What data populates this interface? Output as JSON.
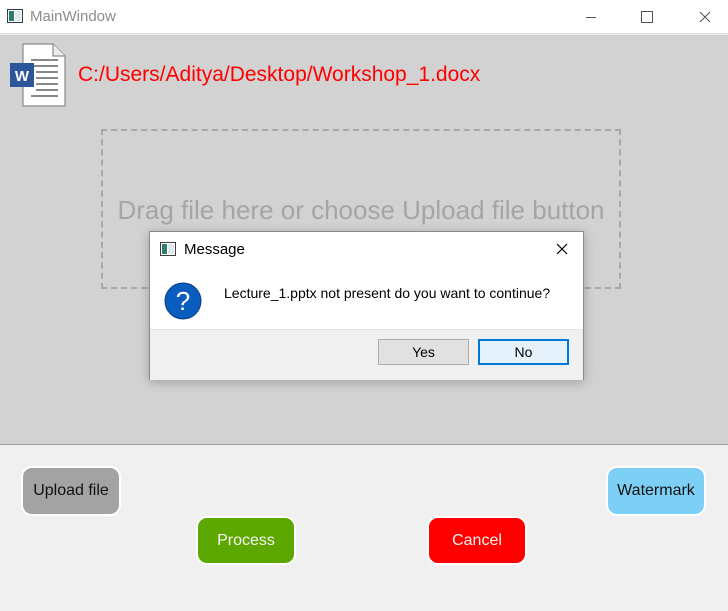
{
  "window": {
    "title": "MainWindow",
    "controls": {
      "minimize": "minimize",
      "maximize": "maximize",
      "close": "close"
    }
  },
  "file": {
    "path": "C:/Users/Aditya/Desktop/Workshop_1.docx",
    "icon": "word-document-icon"
  },
  "drop_zone": {
    "text": "Drag file here or choose Upload file button"
  },
  "buttons": {
    "upload": "Upload file",
    "watermark": "Watermark",
    "process": "Process",
    "cancel": "Cancel"
  },
  "dialog": {
    "title": "Message",
    "message": "Lecture_1.pptx not present do you want to continue?",
    "icon": "question-icon",
    "yes": "Yes",
    "no": "No"
  },
  "colors": {
    "path_text": "#ff0000",
    "upload": "#a3a3a3",
    "watermark": "#7ecff5",
    "process": "#5ca800",
    "cancel": "#ff0000",
    "question_icon": "#0a5cbf"
  }
}
